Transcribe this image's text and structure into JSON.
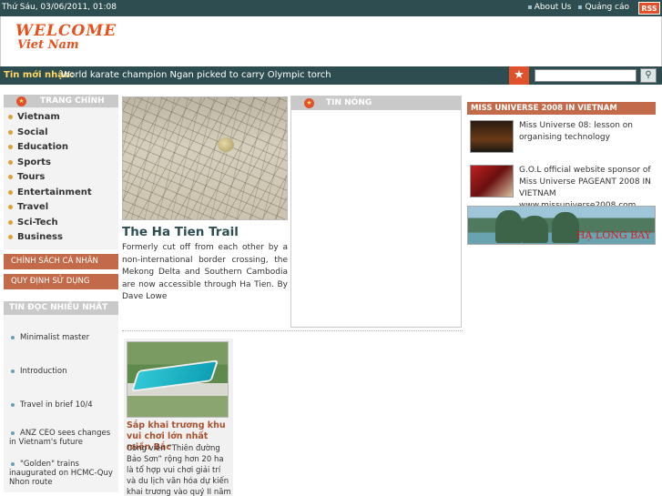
{
  "topbar": {
    "date": "Thứ Sáu, 03/06/2011, 01:08",
    "about": "About Us",
    "ads": "Quảng cáo",
    "rss": "RSS"
  },
  "logo": {
    "line1": "WELCOME",
    "line2": "Viet Nam"
  },
  "newsbar": {
    "label": "Tin mới nhận:",
    "headline": "World karate champion Ngan picked to carry Olympic torch",
    "search_placeholder": ""
  },
  "sidebar": {
    "home_title": "TRANG CHÍNH",
    "items": [
      {
        "label": "Vietnam"
      },
      {
        "label": "Social"
      },
      {
        "label": "Education"
      },
      {
        "label": "Sports"
      },
      {
        "label": "Tours"
      },
      {
        "label": "Entertainment"
      },
      {
        "label": "Travel"
      },
      {
        "label": "Sci-Tech"
      },
      {
        "label": "Business"
      }
    ],
    "privacy": "CHÍNH SÁCH CÁ NHÂN",
    "terms": "QUY ĐỊNH SỬ DỤNG",
    "most_read_title": "TIN ĐỌC NHIỀU NHẤT",
    "most_read": [
      {
        "label": "Minimalist master"
      },
      {
        "label": "Introduction"
      },
      {
        "label": "Travel in brief 10/4"
      },
      {
        "label": "ANZ CEO sees changes in Vietnam's future"
      },
      {
        "label": "\"Golden\" trains inaugurated on HCMC-Quy Nhon route"
      }
    ]
  },
  "feature": {
    "title": "The Ha Tien Trail",
    "summary": "Formerly cut off from each other by a non-international border crossing, the Mekong Delta and Southern Cambodia are now accessible through Ha Tien. By Dave Lowe"
  },
  "hot_news": {
    "title": "TIN NÓNG"
  },
  "card": {
    "title": "Sắp khai trương khu vui chơi lớn nhất miền Bắc",
    "summary": "Công viên “Thiên đường Bảo Sơn” rộng hơn 20 ha là tổ hợp vui chơi giải trí và du lịch văn hóa dự kiến khai trương vào quý II năm"
  },
  "miss_universe": {
    "title": "MISS UNIVERSE 2008 IN VIETNAM",
    "items": [
      {
        "text": "Miss Universe 08: lesson on organising technology"
      },
      {
        "text": "G.O.L official website sponsor of Miss Universe PAGEANT 2008 IN VIETNAM www.missuniverse2008.com"
      }
    ],
    "banner_caption": "HẠ LONG BAY"
  }
}
